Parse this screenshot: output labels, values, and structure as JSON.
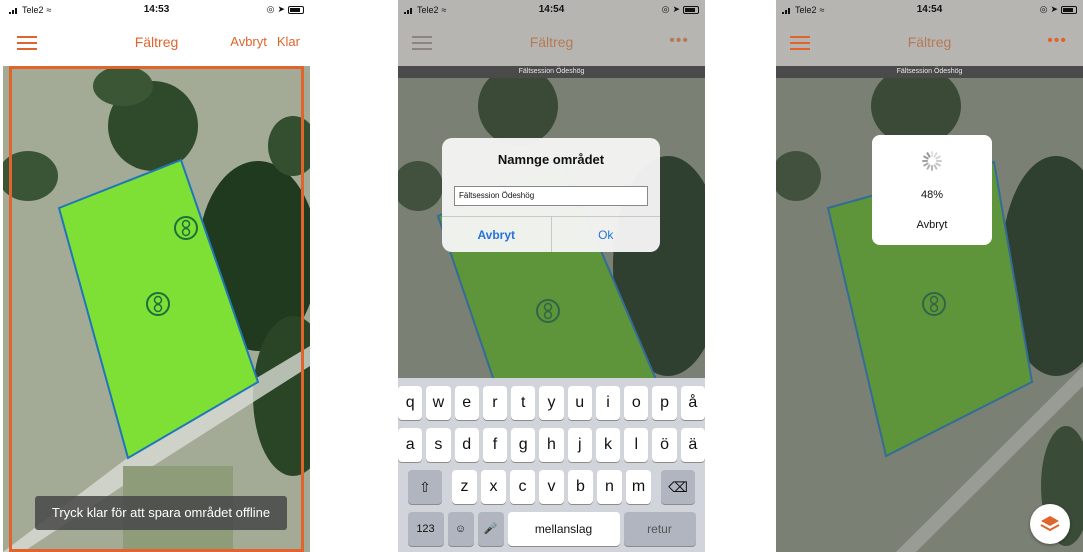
{
  "status": {
    "phone1": {
      "carrier": "Tele2",
      "time": "14:53"
    },
    "phone2": {
      "carrier": "Tele2",
      "time": "14:54"
    },
    "phone3": {
      "carrier": "Tele2",
      "time": "14:54"
    }
  },
  "app": {
    "title": "Fältreg",
    "more_icon": "•••"
  },
  "phone1": {
    "cancel_label": "Avbryt",
    "done_label": "Klar",
    "hint": "Tryck klar för att spara området offline"
  },
  "session_name": "Fältsession Ödeshög",
  "dialog": {
    "title": "Namnge området",
    "input_value": "Fältsession Ödeshög",
    "cancel_label": "Avbryt",
    "ok_label": "Ok"
  },
  "keyboard": {
    "row1": [
      "q",
      "w",
      "e",
      "r",
      "t",
      "y",
      "u",
      "i",
      "o",
      "p",
      "å"
    ],
    "row2": [
      "a",
      "s",
      "d",
      "f",
      "g",
      "h",
      "j",
      "k",
      "l",
      "ö",
      "ä"
    ],
    "row3": [
      "z",
      "x",
      "c",
      "v",
      "b",
      "n",
      "m"
    ],
    "numbers_label": "123",
    "space_label": "mellanslag",
    "return_label": "retur"
  },
  "download": {
    "progress_percent": 48,
    "progress_text": "48%",
    "cancel_label": "Avbryt"
  },
  "colors": {
    "accent": "#e0642c",
    "field_fill": "#7ee034",
    "field_border": "#1f77b8",
    "dialog_button": "#2475d9"
  },
  "icons": {
    "menu": "hamburger-icon",
    "marker": "location-marker-icon",
    "layers": "layers-icon",
    "emoji": "emoji-icon",
    "mic": "microphone-icon",
    "shift": "shift-icon",
    "backspace": "backspace-icon"
  }
}
